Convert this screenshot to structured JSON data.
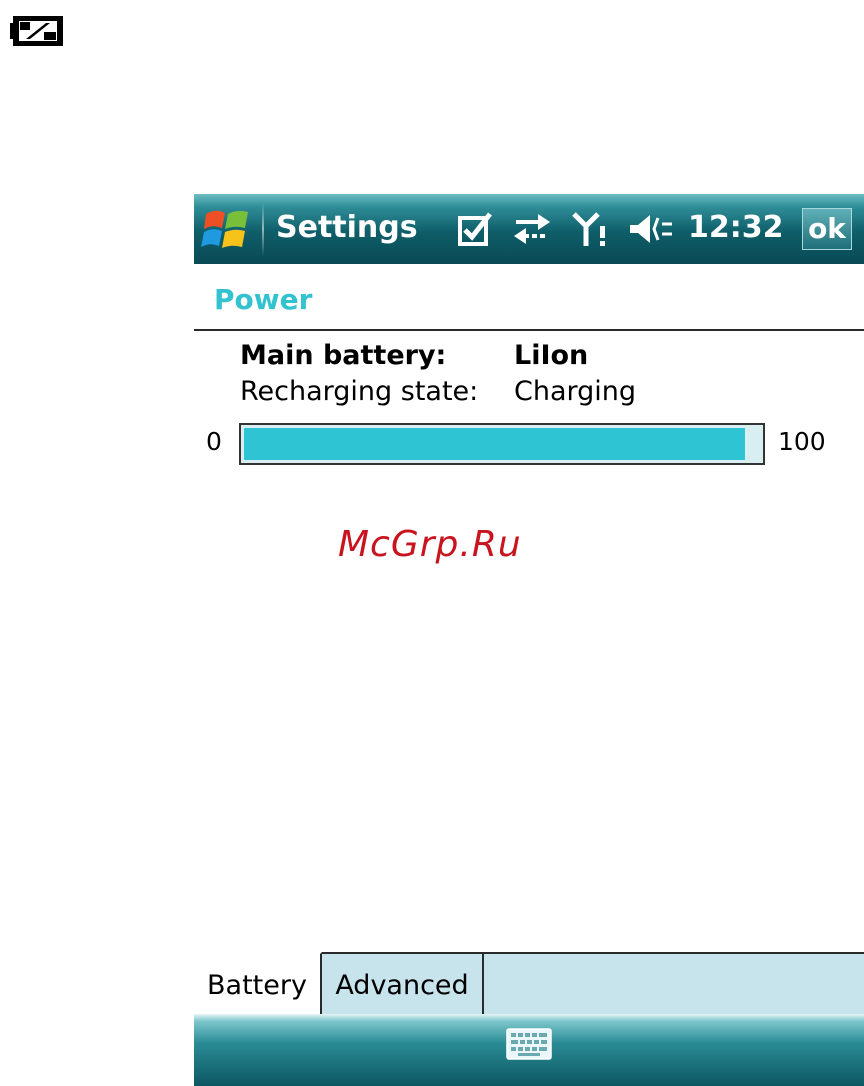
{
  "titlebar": {
    "title": "Settings",
    "clock": "12:32",
    "ok_label": "ok",
    "icons": [
      "windows-start-icon",
      "checkbox-icon",
      "connectivity-arrows-icon",
      "antenna-no-signal-icon",
      "speaker-volume-icon"
    ]
  },
  "section": {
    "title": "Power"
  },
  "battery": {
    "main_label": "Main battery:",
    "main_value": "LiIon",
    "state_label": "Recharging state:",
    "state_value": "Charging",
    "scale_min": "0",
    "scale_max": "100",
    "level_percent": 97
  },
  "watermark": "McGrp.Ru",
  "tabs": [
    {
      "label": "Battery",
      "active": true
    },
    {
      "label": "Advanced",
      "active": false
    }
  ],
  "menubar": {
    "icon": "keyboard-icon"
  },
  "colors": {
    "accent": "#33c2cf",
    "progress_fill": "#2fc4d4",
    "titlebar_dark": "#0a4a54",
    "tab_inactive": "#c7e3ec",
    "watermark": "#c8141e"
  }
}
